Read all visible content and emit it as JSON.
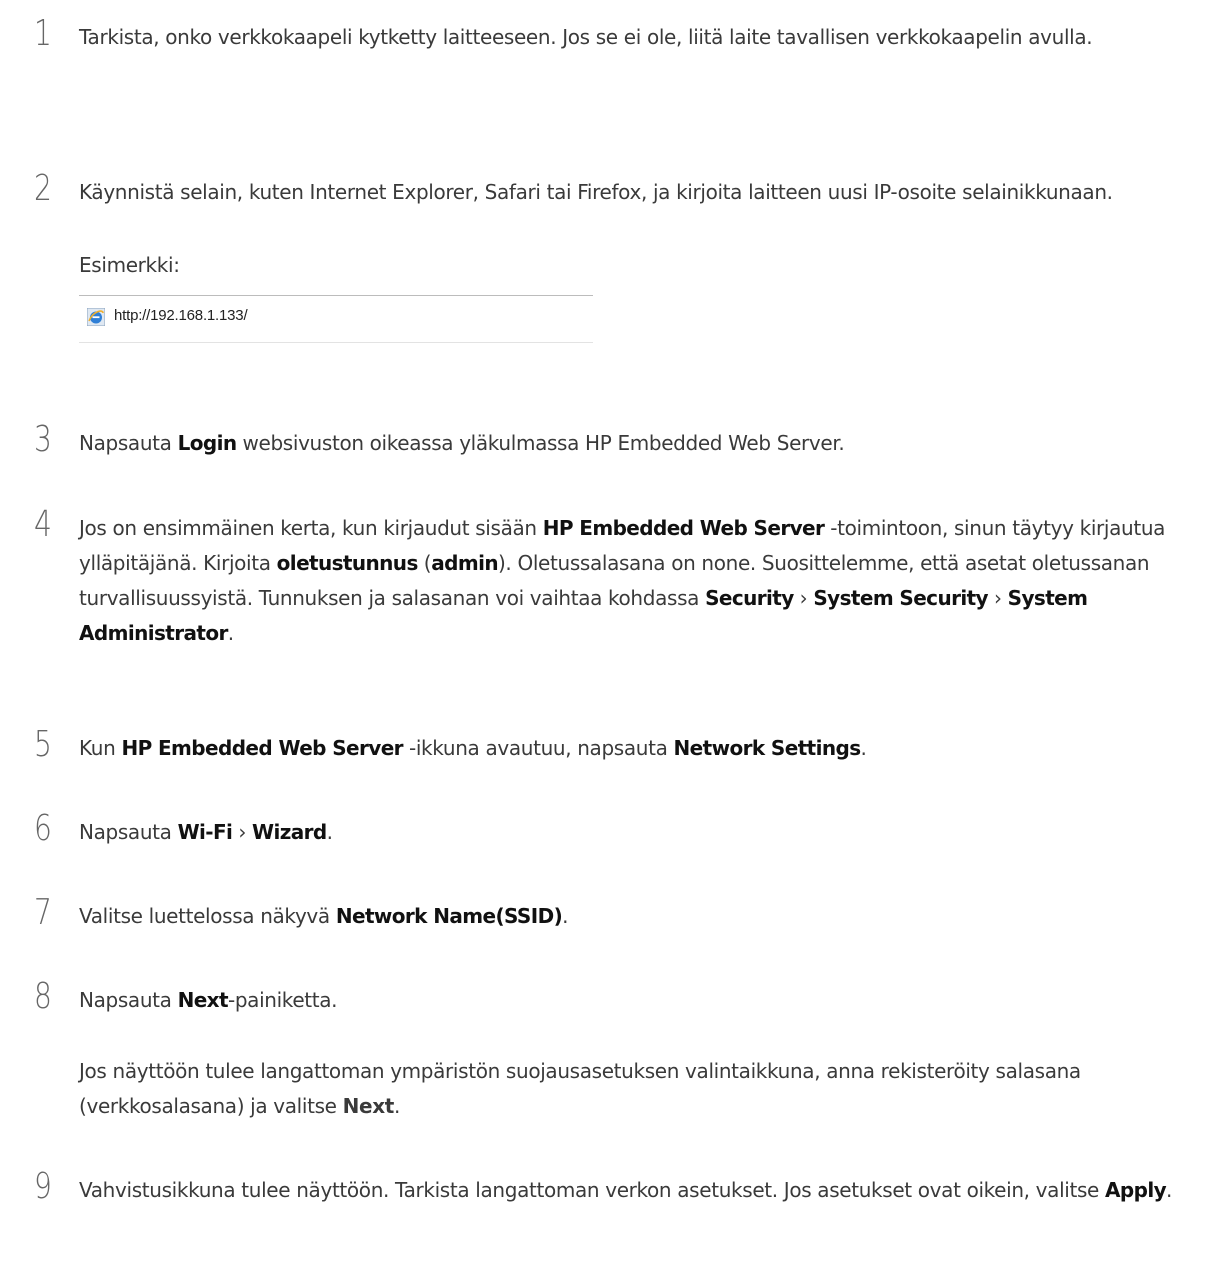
{
  "steps": [
    {
      "n": "1",
      "parts": [
        {
          "t": "Tarkista, onko verkkokaapeli kytketty laitteeseen. Jos se ei ole, liitä laite tavallisen verkkokaapelin avulla."
        }
      ]
    },
    {
      "n": "2",
      "parts": [
        {
          "t": "Käynnistä selain, kuten Internet Explorer, Safari tai Firefox, ja kirjoita laitteen uusi IP-osoite selainikkunaan."
        }
      ]
    },
    {
      "n": "3",
      "parts": [
        {
          "t": "Napsauta "
        },
        {
          "t": "Login",
          "b": true
        },
        {
          "t": " websivuston oikeassa yläkulmassa HP Embedded Web Server."
        }
      ]
    },
    {
      "n": "4",
      "parts": [
        {
          "t": "Jos on ensimmäinen kerta, kun kirjaudut sisään "
        },
        {
          "t": "HP Embedded Web Server",
          "b": true
        },
        {
          "t": " -toimintoon, sinun täytyy kirjautua ylläpitäjänä. Kirjoita "
        },
        {
          "t": "oletustunnus",
          "b": true
        },
        {
          "t": " ("
        },
        {
          "t": "admin",
          "b": true
        },
        {
          "t": "). Oletussalasana on none. Suosittelemme, että asetat oletussanan turvallisuussyistä. Tunnuksen ja salasanan voi vaihtaa kohdassa "
        },
        {
          "t": "Security",
          "b": true
        },
        {
          "t": " › "
        },
        {
          "t": "System Security",
          "b": true
        },
        {
          "t": " › "
        },
        {
          "t": "System Administrator",
          "b": true
        },
        {
          "t": "."
        }
      ]
    },
    {
      "n": "5",
      "parts": [
        {
          "t": "Kun "
        },
        {
          "t": "HP Embedded Web Server",
          "b": true
        },
        {
          "t": " -ikkuna avautuu, napsauta "
        },
        {
          "t": "Network Settings",
          "b": true
        },
        {
          "t": "."
        }
      ]
    },
    {
      "n": "6",
      "parts": [
        {
          "t": "Napsauta "
        },
        {
          "t": "Wi-Fi",
          "b": true
        },
        {
          "t": " › "
        },
        {
          "t": "Wizard",
          "b": true
        },
        {
          "t": "."
        }
      ]
    },
    {
      "n": "7",
      "parts": [
        {
          "t": "Valitse luettelossa näkyvä "
        },
        {
          "t": "Network Name(SSID)",
          "b": true
        },
        {
          "t": "."
        }
      ]
    },
    {
      "n": "8",
      "parts": [
        {
          "t": "Napsauta "
        },
        {
          "t": "Next",
          "b": true
        },
        {
          "t": "-painiketta."
        }
      ]
    },
    {
      "n": "9",
      "parts": [
        {
          "t": "Vahvistusikkuna tulee näyttöön. Tarkista langattoman verkon asetukset. Jos asetukset ovat oikein, valitse "
        },
        {
          "t": "Apply",
          "b": true
        },
        {
          "t": "."
        }
      ]
    }
  ],
  "example_label": "Esimerkki:",
  "example_url": "http://192.168.1.133/",
  "example_icon": "internet-explorer-icon",
  "step8_note": {
    "parts": [
      {
        "t": "Jos näyttöön tulee langattoman ympäristön suojausasetuksen valintaikkuna, anna rekisteröity salasana (verkkosalasana) ja valitse "
      },
      {
        "t": "Next",
        "b": true
      },
      {
        "t": "."
      }
    ]
  }
}
